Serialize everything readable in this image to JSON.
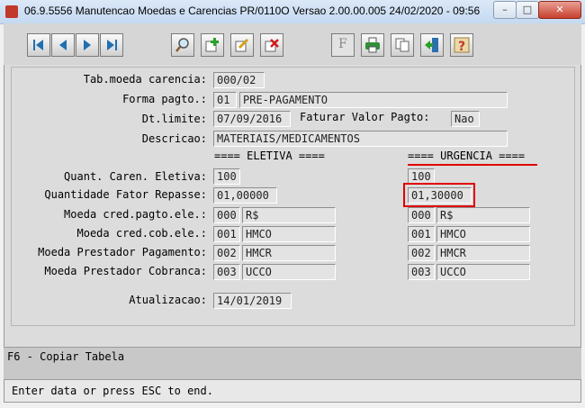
{
  "window": {
    "title": "06.9.5556 Manutencao  Moedas e Carencias PR/0110O Versao 2.00.00.005 24/02/2020 - 09:56",
    "minimize": "–",
    "maximize": "□",
    "close": "✕"
  },
  "toolbar": {
    "buttons": [
      {
        "name": "first-record-icon"
      },
      {
        "name": "prev-record-icon"
      },
      {
        "name": "next-record-icon"
      },
      {
        "name": "last-record-icon"
      },
      {
        "name": "search-icon"
      },
      {
        "name": "add-icon"
      },
      {
        "name": "edit-icon"
      },
      {
        "name": "delete-icon"
      },
      {
        "name": "filter-icon"
      },
      {
        "name": "print-icon"
      },
      {
        "name": "copy-icon"
      },
      {
        "name": "exit-icon"
      },
      {
        "name": "help-icon"
      }
    ],
    "filter_letter": "F"
  },
  "form": {
    "tab_moeda_label": "Tab.moeda carencia:",
    "tab_moeda_value": "000/02",
    "forma_pagto_label": "Forma pagto.:",
    "forma_pagto_code": "01",
    "forma_pagto_desc": "PRE-PAGAMENTO",
    "dt_limite_label": "Dt.limite:",
    "dt_limite_value": "07/09/2016",
    "faturar_label": "Faturar Valor Pagto:",
    "faturar_value": "Nao",
    "descricao_label": "Descricao:",
    "descricao_value": "MATERIAIS/MEDICAMENTOS",
    "eletiva_header": "==== ELETIVA ====",
    "urgencia_header": "==== URGENCIA ====",
    "rows": {
      "quant_caren": {
        "label": "Quant. Caren. Eletiva:",
        "eletiva": "100",
        "urgencia": "100"
      },
      "fator_repasse": {
        "label": "Quantidade Fator Repasse:",
        "eletiva": "01,00000",
        "urgencia": "01,30000"
      },
      "moeda_pagto": {
        "label": "Moeda cred.pagto.ele.:",
        "eletiva_code": "000",
        "eletiva_desc": "R$",
        "urgencia_code": "000",
        "urgencia_desc": "R$"
      },
      "moeda_cob": {
        "label": "Moeda cred.cob.ele.:",
        "eletiva_code": "001",
        "eletiva_desc": "HMCO",
        "urgencia_code": "001",
        "urgencia_desc": "HMCO"
      },
      "moeda_prest_pag": {
        "label": "Moeda Prestador Pagamento:",
        "eletiva_code": "002",
        "eletiva_desc": "HMCR",
        "urgencia_code": "002",
        "urgencia_desc": "HMCR"
      },
      "moeda_prest_cob": {
        "label": "Moeda Prestador Cobranca:",
        "eletiva_code": "003",
        "eletiva_desc": "UCCO",
        "urgencia_code": "003",
        "urgencia_desc": "UCCO"
      }
    },
    "atualizacao_label": "Atualizacao:",
    "atualizacao_value": "14/01/2019"
  },
  "function_keys": "F6 - Copiar Tabela",
  "status": "Enter data or press ESC to end.",
  "colors": {
    "highlight": "#e00000"
  }
}
